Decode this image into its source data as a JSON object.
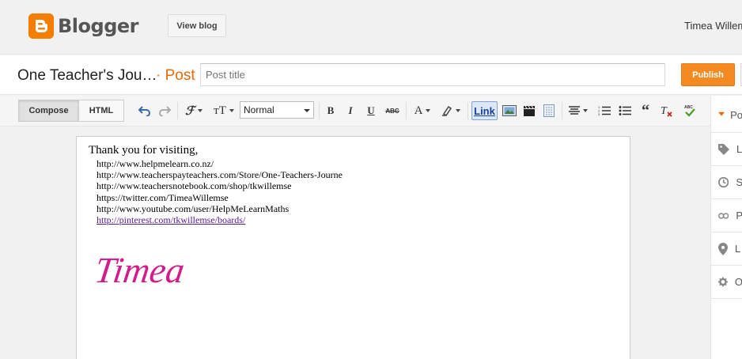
{
  "brand": {
    "name": "Blogger",
    "accent": "#f57d00"
  },
  "header": {
    "view_blog_label": "View blog",
    "user_name": "Timea Willemse"
  },
  "title_row": {
    "blog_name": "One Teacher's Jou…",
    "separator": "·",
    "section": "Post",
    "title_placeholder": "Post title",
    "title_value": "",
    "publish_label": "Publish"
  },
  "toolbar": {
    "compose_label": "Compose",
    "html_label": "HTML",
    "font_size_value": "Normal",
    "link_label": "Link",
    "icons": [
      "undo-icon",
      "redo-icon",
      "font-icon",
      "text-size-icon",
      "bold-icon",
      "italic-icon",
      "underline-icon",
      "strikethrough-icon",
      "text-color-icon",
      "highlight-icon",
      "link-icon",
      "image-icon",
      "video-icon",
      "jump-break-icon",
      "align-icon",
      "numbered-list-icon",
      "bullet-list-icon",
      "quote-icon",
      "remove-formatting-icon",
      "spellcheck-icon"
    ]
  },
  "editor": {
    "greeting": "Thank you for visiting,",
    "links": [
      "http://www.helpmelearn.co.nz/",
      "http://www.teacherspayteachers.com/Store/One-Teachers-Journe",
      "http://www.teachersnotebook.com/shop/tkwillemse",
      "https://twitter.com/TimeaWillemse",
      "http://www.youtube.com/user/HelpMeLearnMaths"
    ],
    "hyperlink": "http://pinterest.com/tkwillemse/boards/",
    "signature": "Timea"
  },
  "sidebar": {
    "items": [
      {
        "icon": "post-settings-icon",
        "label": "Po"
      },
      {
        "icon": "label-tag-icon",
        "label": "L"
      },
      {
        "icon": "schedule-clock-icon",
        "label": "S"
      },
      {
        "icon": "permalink-icon",
        "label": "P"
      },
      {
        "icon": "location-pin-icon",
        "label": "L"
      },
      {
        "icon": "options-gear-icon",
        "label": "O"
      }
    ]
  }
}
